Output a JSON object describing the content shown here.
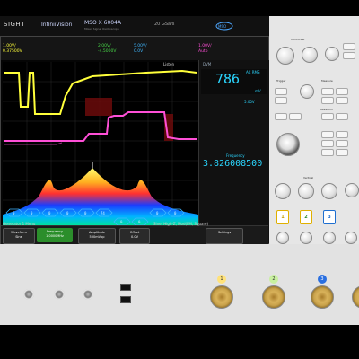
{
  "brand": {
    "company": "SIGHT",
    "series": "InfiniiVision",
    "model": "MSO X 6004A",
    "model_sub": "Mixed Signal Oscilloscope",
    "rate": "20 GSa/s"
  },
  "channels": [
    {
      "id": "1",
      "scale": "1.00V/",
      "offset": "0.37500V"
    },
    {
      "id": "2",
      "scale": "2.00V/",
      "offset": "-4.5000V"
    },
    {
      "id": "3",
      "scale": "5.00V/",
      "offset": "0.0V"
    },
    {
      "id": "4",
      "scale": "1.00V/",
      "offset": "1.00V"
    }
  ],
  "acq": {
    "mode": "Auto"
  },
  "listen": "Listen",
  "dvm": {
    "label": "DVM",
    "value": "786",
    "unit": "mV",
    "mode": "AC RMS",
    "range": "5.00V"
  },
  "frequency": {
    "label": "Frequency",
    "value": "3.826008500"
  },
  "colors": {
    "ch1": "#ffff3a",
    "ch2": "#48d848",
    "ch3": "#3fb7ff",
    "ch4": "#ff4fd7"
  },
  "softmenu": {
    "title": "Generator 1 Menu",
    "info": "Sine, High-Z, Mod(FM, Square)",
    "keys": [
      {
        "title": "Waveform",
        "value": "Sine"
      },
      {
        "title": "Frequency",
        "value": "1.0000MHz"
      },
      {
        "title": "Amplitude",
        "value": "500mVpp"
      },
      {
        "title": "Offset",
        "value": "0.0V"
      },
      {
        "title": "Settings",
        "value": ""
      }
    ]
  },
  "panel": {
    "horizontal": "Horizontal",
    "trigger": "Trigger",
    "measure": "Measure",
    "waveform": "Waveform",
    "vertical": "Vertical",
    "channel_buttons": [
      "1",
      "2",
      "3"
    ]
  },
  "inputs": [
    "1",
    "2",
    "3"
  ],
  "decode_labels": [
    "0",
    "0",
    "0",
    "0",
    "0",
    "74",
    "0",
    "0",
    "0",
    "0"
  ]
}
